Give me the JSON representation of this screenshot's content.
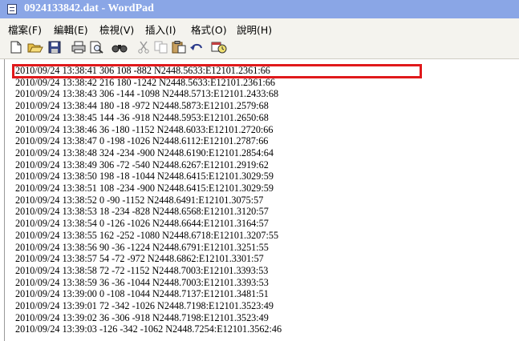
{
  "window": {
    "title": "0924133842.dat - WordPad"
  },
  "menu": {
    "items": [
      {
        "label": "檔案(F)"
      },
      {
        "label": "編輯(E)"
      },
      {
        "label": "檢視(V)"
      },
      {
        "label": "插入(I)"
      },
      {
        "label": "格式(O)"
      },
      {
        "label": "說明(H)"
      }
    ]
  },
  "toolbar": {
    "icons": [
      "new-document-icon",
      "open-folder-icon",
      "save-icon",
      "print-icon",
      "print-preview-icon",
      "find-icon",
      "cut-icon",
      "copy-icon",
      "paste-icon",
      "undo-icon",
      "date-time-icon"
    ]
  },
  "document": {
    "highlight_color": "#e0191b",
    "lines": [
      "2010/09/24 13:38:41 306 108 -882 N2448.5633:E12101.2361:66",
      "2010/09/24 13:38:42 216 180 -1242 N2448.5633:E12101.2361:66",
      "2010/09/24 13:38:43 306 -144 -1098 N2448.5713:E12101.2433:68",
      "2010/09/24 13:38:44 180 -18 -972 N2448.5873:E12101.2579:68",
      "2010/09/24 13:38:45 144 -36 -918 N2448.5953:E12101.2650:68",
      "2010/09/24 13:38:46 36 -180 -1152 N2448.6033:E12101.2720:66",
      "2010/09/24 13:38:47 0 -198 -1026 N2448.6112:E12101.2787:66",
      "2010/09/24 13:38:48 324 -234 -900 N2448.6190:E12101.2854:64",
      "2010/09/24 13:38:49 306 -72 -540 N2448.6267:E12101.2919:62",
      "2010/09/24 13:38:50 198 -18 -1044 N2448.6415:E12101.3029:59",
      "2010/09/24 13:38:51 108 -234 -900 N2448.6415:E12101.3029:59",
      "2010/09/24 13:38:52 0 -90 -1152 N2448.6491:E12101.3075:57",
      "2010/09/24 13:38:53 18 -234 -828 N2448.6568:E12101.3120:57",
      "2010/09/24 13:38:54 0 -126 -1026 N2448.6644:E12101.3164:57",
      "2010/09/24 13:38:55 162 -252 -1080 N2448.6718:E12101.3207:55",
      "2010/09/24 13:38:56 90 -36 -1224 N2448.6791:E12101.3251:55",
      "2010/09/24 13:38:57 54 -72 -972 N2448.6862:E12101.3301:57",
      "2010/09/24 13:38:58 72 -72 -1152 N2448.7003:E12101.3393:53",
      "2010/09/24 13:38:59 36 -36 -1044 N2448.7003:E12101.3393:53",
      "2010/09/24 13:39:00 0 -108 -1044 N2448.7137:E12101.3481:51",
      "2010/09/24 13:39:01 72 -342 -1026 N2448.7198:E12101.3523:49",
      "2010/09/24 13:39:02 36 -306 -918 N2448.7198:E12101.3523:49",
      "2010/09/24 13:39:03 -126 -342 -1062 N2448.7254:E12101.3562:46"
    ]
  }
}
